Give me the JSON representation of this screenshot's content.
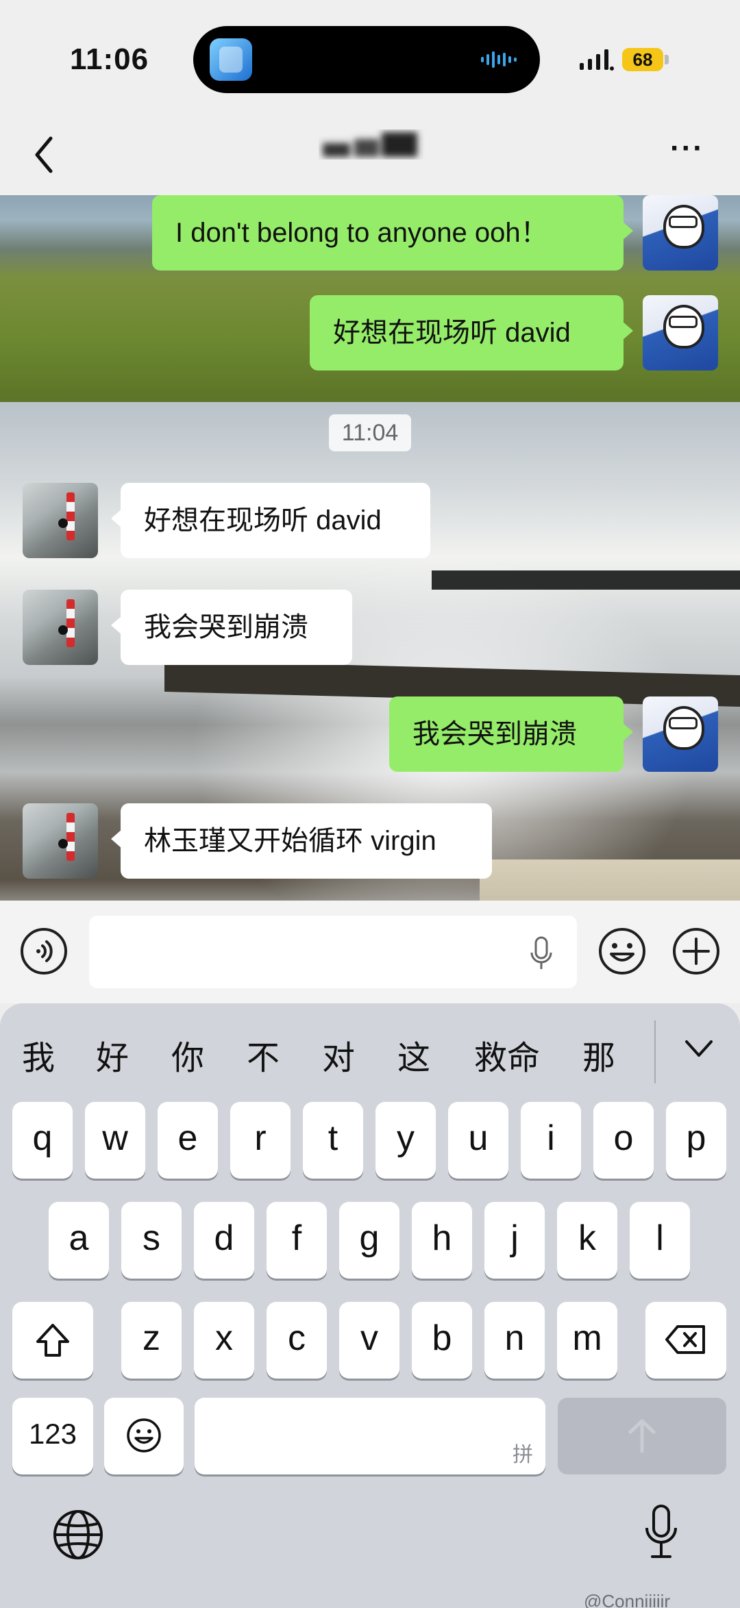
{
  "status_bar": {
    "time": "11:06",
    "battery": "68",
    "battery_color": "#f5c518"
  },
  "navbar": {
    "back_icon": "chevron-left-icon",
    "title": "",
    "more_label": "···"
  },
  "chat": {
    "timestamp": "11:04",
    "bubble_me_color": "#95ec69",
    "messages": [
      {
        "sender": "me",
        "text": "I don't belong to anyone ooh！"
      },
      {
        "sender": "me",
        "text": "好想在现场听 david"
      },
      {
        "sender": "other",
        "text": "好想在现场听 david"
      },
      {
        "sender": "other",
        "text": "我会哭到崩溃"
      },
      {
        "sender": "me",
        "text": "我会哭到崩溃"
      },
      {
        "sender": "other",
        "text": "林玉瑾又开始循环 virgin"
      }
    ]
  },
  "input_bar": {
    "text_value": ""
  },
  "keyboard": {
    "candidates": [
      "我",
      "好",
      "你",
      "不",
      "对",
      "这",
      "救命",
      "那"
    ],
    "row1": [
      "q",
      "w",
      "e",
      "r",
      "t",
      "y",
      "u",
      "i",
      "o",
      "p"
    ],
    "row2": [
      "a",
      "s",
      "d",
      "f",
      "g",
      "h",
      "j",
      "k",
      "l"
    ],
    "row3": [
      "z",
      "x",
      "c",
      "v",
      "b",
      "n",
      "m"
    ],
    "numbers_label": "123",
    "space_hint": "拼"
  },
  "watermark": "@Conniiiiir"
}
